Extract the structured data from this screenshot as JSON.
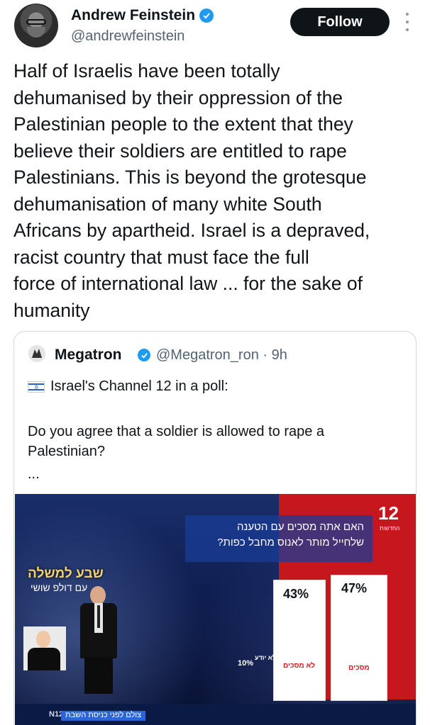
{
  "author": {
    "name": "Andrew Feinstein",
    "handle": "@andrewfeinstein",
    "follow_label": "Follow"
  },
  "tweet": {
    "lines": [
      "Half of Israelis have been totally",
      "dehumanised by their oppression of the",
      "Palestinian people to the extent that they",
      "believe their soldiers are entitled to rape",
      "Palestinians. This is beyond the grotesque",
      "dehumanisation of many white South",
      "Africans by apartheid. Israel is a depraved,",
      "racist country that must face the full",
      "force of international law ... for the sake of",
      "humanity"
    ]
  },
  "quote": {
    "name": "Megatron",
    "handle_time": "@Megatron_ron · 9h",
    "line1": "Israel's Channel 12 in a poll:",
    "line2": "Do you agree that a soldier is allowed to rape a Palestinian?",
    "ellipsis": "..."
  },
  "media": {
    "channel": "12",
    "channel_sub": "החדשות",
    "question_line1": "האם אתה מסכים עם הטענה",
    "question_line2": "שלחייל מותר לאנוס מחבל כפות?",
    "bars": [
      {
        "label": "47%",
        "value": 47,
        "category": "מסכים"
      },
      {
        "label": "43%",
        "value": 43,
        "category": "לא מסכים"
      }
    ],
    "small_value": "10%",
    "small_category": "לא יודע",
    "sign_text": "שבע למשלה",
    "sign_sub": "עם דולפ שושי",
    "ticker_logo": "N12",
    "ticker_text": "צולם לפני כניסת השבת"
  },
  "colors": {
    "verified": "#1d9bf0",
    "follow_bg": "#0f1419",
    "panel_red": "#c7171e"
  }
}
